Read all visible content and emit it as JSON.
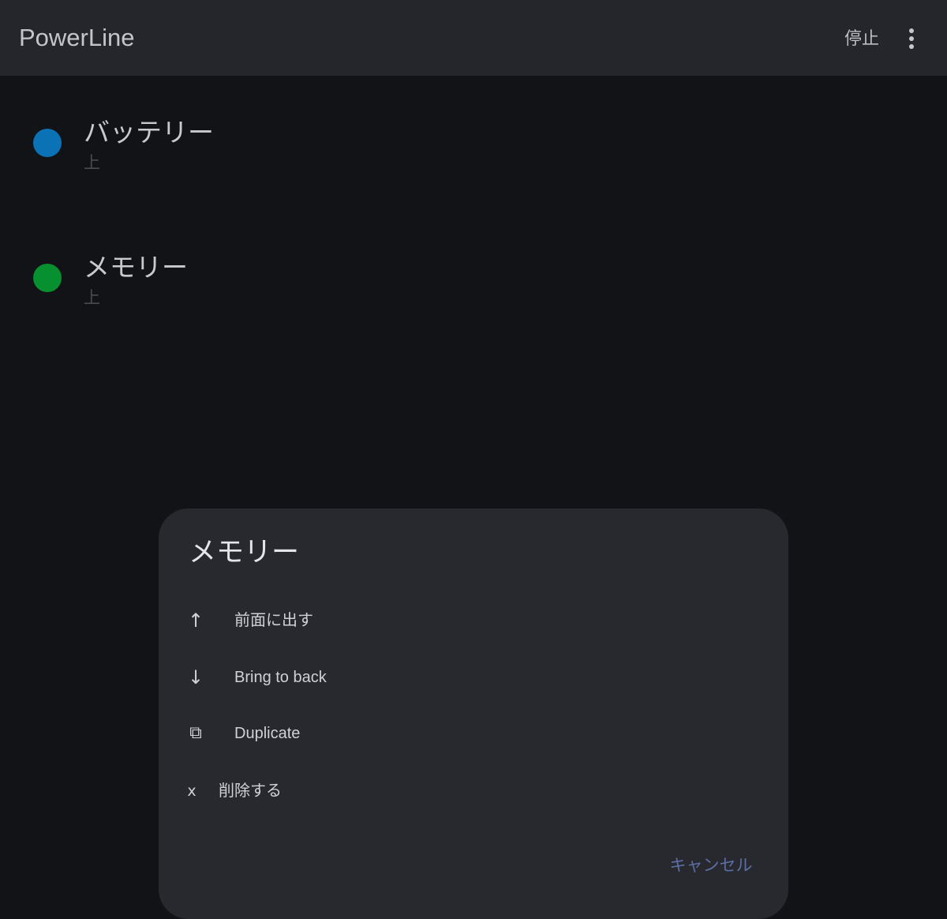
{
  "app_bar": {
    "title": "PowerLine",
    "stop_label": "停止",
    "more_icon": "more-vertical-icon"
  },
  "list": {
    "items": [
      {
        "title": "バッテリー",
        "subtitle": "上",
        "color": "#0a72b5"
      },
      {
        "title": "メモリー",
        "subtitle": "上",
        "color": "#07902f"
      }
    ]
  },
  "dialog": {
    "title": "メモリー",
    "options": [
      {
        "icon": "↑",
        "icon_name": "arrow-up-icon",
        "label": "前面に出す"
      },
      {
        "icon": "↓",
        "icon_name": "arrow-down-icon",
        "label": "Bring to back"
      },
      {
        "icon": "⧉",
        "icon_name": "duplicate-icon",
        "label": "Duplicate"
      },
      {
        "icon": "x",
        "icon_name": "close-icon",
        "label": "削除する"
      }
    ],
    "cancel_label": "キャンセル"
  },
  "colors": {
    "background": "#121317",
    "app_bar": "#25262b",
    "dialog": "#28292f",
    "accent": "#5c6fa5"
  }
}
